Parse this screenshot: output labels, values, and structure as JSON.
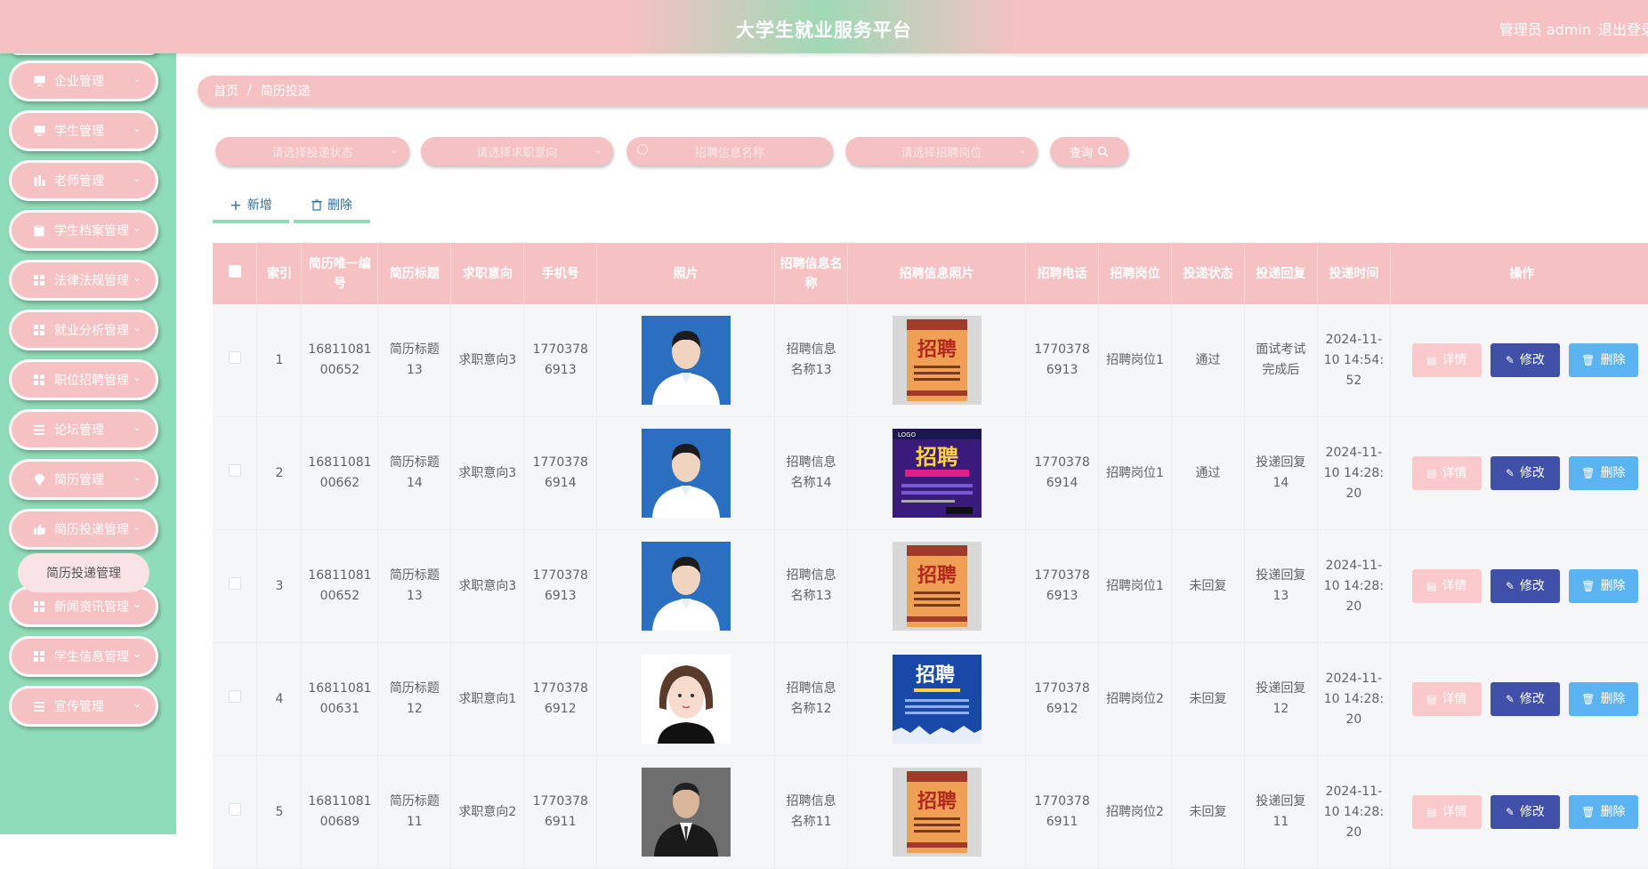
{
  "header": {
    "title": "大学生就业服务平台",
    "admin": "管理员 admin",
    "logout": "退出登录"
  },
  "sidebar": {
    "items": [
      {
        "label": "企业管理",
        "icon": "monitor-icon"
      },
      {
        "label": "学生管理",
        "icon": "monitor-icon"
      },
      {
        "label": "老师管理",
        "icon": "chart-icon"
      },
      {
        "label": "学生档案管理",
        "icon": "clipboard-icon"
      },
      {
        "label": "法律法规管理",
        "icon": "grid-icon"
      },
      {
        "label": "就业分析管理",
        "icon": "grid-icon"
      },
      {
        "label": "职位招聘管理",
        "icon": "grid-icon"
      },
      {
        "label": "论坛管理",
        "icon": "list-icon"
      },
      {
        "label": "简历管理",
        "icon": "location-icon"
      },
      {
        "label": "简历投递管理",
        "icon": "thumb-icon"
      },
      {
        "label": "新闻资讯管理",
        "icon": "grid-icon"
      },
      {
        "label": "学生信息管理",
        "icon": "grid-icon"
      },
      {
        "label": "宣传管理",
        "icon": "list-icon"
      }
    ],
    "submenu": {
      "label": "简历投递管理"
    }
  },
  "breadcrumb": {
    "home": "首页",
    "separator": "/",
    "current": "简历投递"
  },
  "filters": {
    "status_placeholder": "请选择投递状态",
    "intent_placeholder": "请选择求职意向",
    "name_placeholder": "招聘信息名称",
    "position_placeholder": "请选择招聘岗位",
    "query_label": "查询"
  },
  "actions": {
    "add_label": "新增",
    "delete_label": "删除"
  },
  "table": {
    "headers": {
      "index": "索引",
      "resume_no": "简历唯一编号",
      "resume_title": "简历标题",
      "intent": "求职意向",
      "phone": "手机号",
      "photo": "照片",
      "recruit_name": "招聘信息名称",
      "recruit_photo": "招聘信息照片",
      "recruit_phone": "招聘电话",
      "recruit_post": "招聘岗位",
      "status": "投递状态",
      "reply": "投递回复",
      "time": "投递时间",
      "ops": "操作"
    },
    "rows": [
      {
        "index": "1",
        "resume_no": "1681108100652",
        "resume_title": "简历标题13",
        "intent": "求职意向3",
        "phone": "17703786913",
        "photo": "man-blue-bg",
        "recruit_name": "招聘信息名称13",
        "recruit_photo": "poster-hanging",
        "recruit_phone": "17703786913",
        "recruit_post": "招聘岗位1",
        "status": "通过",
        "reply": "面试考试完成后",
        "time": "2024-11-10 14:54:52"
      },
      {
        "index": "2",
        "resume_no": "1681108100662",
        "resume_title": "简历标题14",
        "intent": "求职意向3",
        "phone": "17703786914",
        "photo": "man-blue-bg",
        "recruit_name": "招聘信息名称14",
        "recruit_photo": "poster-purple",
        "recruit_phone": "17703786914",
        "recruit_post": "招聘岗位1",
        "status": "通过",
        "reply": "投递回复14",
        "time": "2024-11-10 14:28:20"
      },
      {
        "index": "3",
        "resume_no": "1681108100652",
        "resume_title": "简历标题13",
        "intent": "求职意向3",
        "phone": "17703786913",
        "photo": "man-blue-bg",
        "recruit_name": "招聘信息名称13",
        "recruit_photo": "poster-hanging",
        "recruit_phone": "17703786913",
        "recruit_post": "招聘岗位1",
        "status": "未回复",
        "reply": "投递回复13",
        "time": "2024-11-10 14:28:20"
      },
      {
        "index": "4",
        "resume_no": "1681108100631",
        "resume_title": "简历标题12",
        "intent": "求职意向1",
        "phone": "17703786912",
        "photo": "woman-cartoon",
        "recruit_name": "招聘信息名称12",
        "recruit_photo": "poster-blue",
        "recruit_phone": "17703786912",
        "recruit_post": "招聘岗位2",
        "status": "未回复",
        "reply": "投递回复12",
        "time": "2024-11-10 14:28:20"
      },
      {
        "index": "5",
        "resume_no": "1681108100689",
        "resume_title": "简历标题11",
        "intent": "求职意向2",
        "phone": "17703786911",
        "photo": "man-suit",
        "recruit_name": "招聘信息名称11",
        "recruit_photo": "poster-hanging",
        "recruit_phone": "17703786911",
        "recruit_post": "招聘岗位2",
        "status": "未回复",
        "reply": "投递回复11",
        "time": "2024-11-10 14:28:20"
      }
    ],
    "buttons": {
      "detail": "详情",
      "edit": "修改",
      "delete": "删除"
    }
  }
}
